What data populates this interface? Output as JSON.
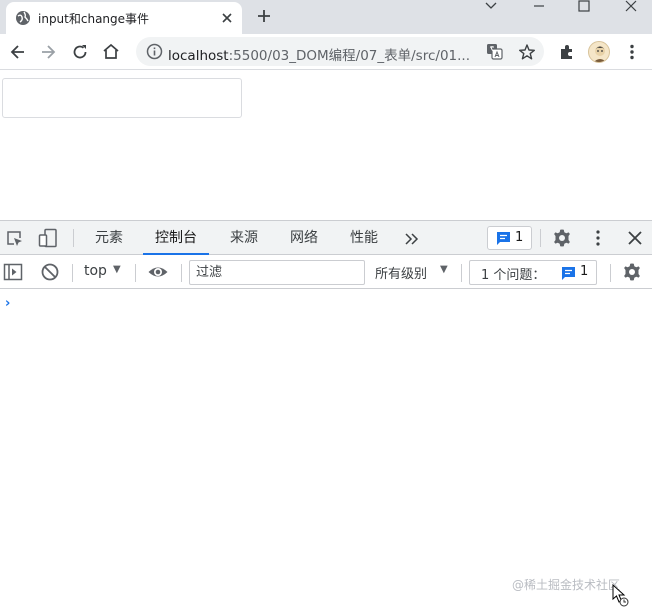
{
  "browser": {
    "tab_title": "input和change事件",
    "url_host": "localhost",
    "url_rest": ":5500/03_DOM编程/07_表单/src/01...",
    "icons": [
      "globe-icon",
      "close-icon",
      "plus-icon",
      "back-icon",
      "forward-icon",
      "reload-icon",
      "home-icon",
      "info-icon",
      "translate-icon",
      "star-icon",
      "extensions-icon",
      "avatar",
      "kebab-menu-icon"
    ]
  },
  "page": {
    "input_value": "",
    "input_placeholder": ""
  },
  "devtools": {
    "tabs": [
      {
        "label": "元素"
      },
      {
        "label": "控制台"
      },
      {
        "label": "来源"
      },
      {
        "label": "网络"
      },
      {
        "label": "性能"
      }
    ],
    "active_tab": "控制台",
    "messages_count": "1",
    "console": {
      "context": "top",
      "filter_placeholder": "过滤",
      "levels": "所有级别",
      "issues_label": "1 个问题：",
      "issues_count": "1",
      "prompt": "›"
    },
    "accent_color": "#1a73e8"
  },
  "watermark": "@稀土掘金技术社区"
}
